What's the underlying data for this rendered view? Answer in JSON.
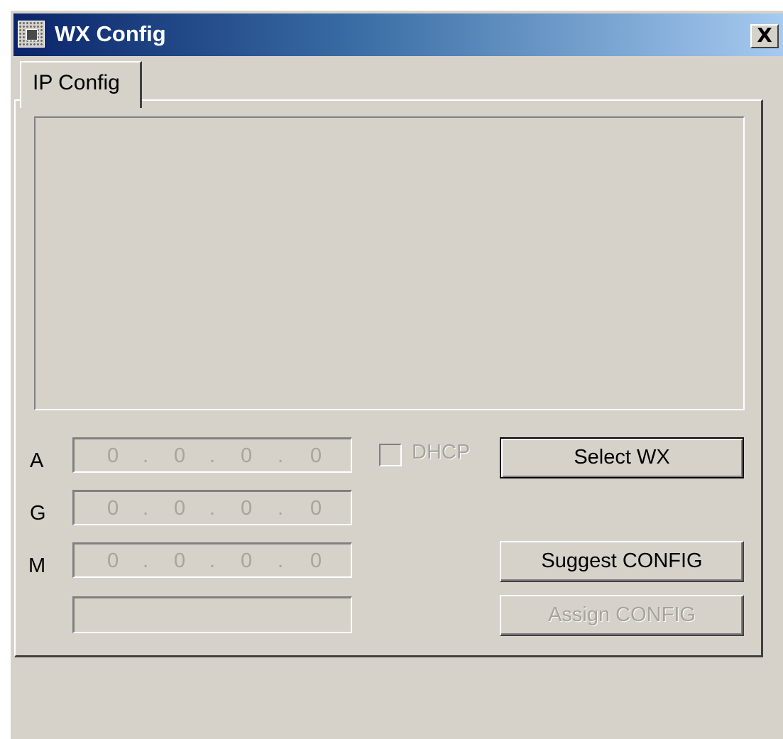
{
  "window": {
    "title": "WX Config",
    "close_glyph": "X",
    "icon": "app-icon"
  },
  "tabs": [
    {
      "label": "IP Config",
      "selected": true
    }
  ],
  "fields": {
    "address": {
      "label": "A",
      "octets": [
        "0",
        "0",
        "0",
        "0"
      ],
      "separator": "."
    },
    "gateway": {
      "label": "G",
      "octets": [
        "0",
        "0",
        "0",
        "0"
      ],
      "separator": "."
    },
    "mask": {
      "label": "M",
      "octets": [
        "0",
        "0",
        "0",
        "0"
      ],
      "separator": "."
    },
    "blank_value": ""
  },
  "dhcp": {
    "label": "DHCP",
    "checked": false,
    "enabled": false
  },
  "buttons": {
    "select_wx": "Select WX",
    "suggest_config": "Suggest CONFIG",
    "assign_config": "Assign CONFIG"
  },
  "colors": {
    "face": "#d6d2ca",
    "title_start": "#0a246a",
    "title_end": "#a6caf0",
    "disabled_text": "#a8a49c"
  }
}
